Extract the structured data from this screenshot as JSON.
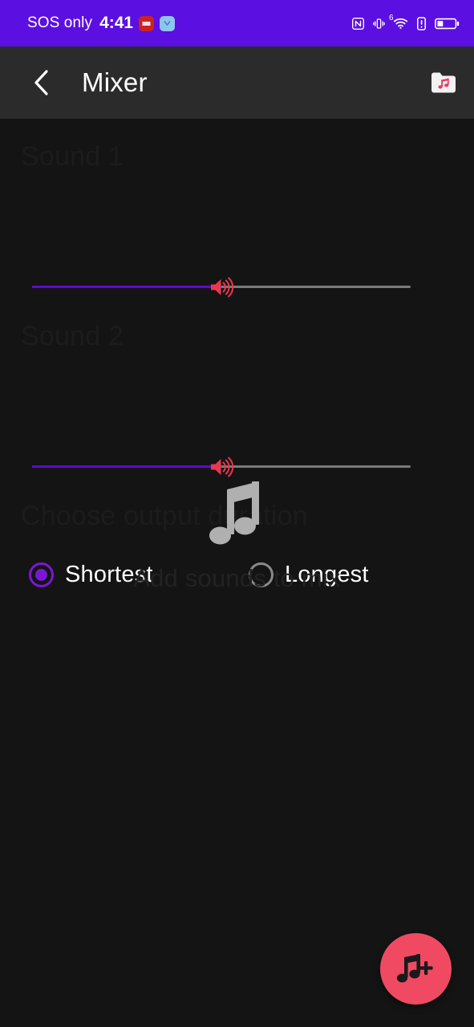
{
  "status_bar": {
    "carrier": "SOS only",
    "time": "4:41",
    "app_badges": [
      {
        "name": "red-app-badge",
        "color": "#cc2222"
      },
      {
        "name": "blue-app-badge",
        "color": "#8fc4ee"
      }
    ],
    "icons": [
      "nfc-icon",
      "vibrate-icon",
      "wifi-icon",
      "alert-icon",
      "battery-icon"
    ],
    "wifi_generation": "6",
    "background_color": "#5B0FE0"
  },
  "app_bar": {
    "back_label": "Back",
    "title": "Mixer",
    "folder_label": "Sound folder",
    "background_color": "#2b2b2b"
  },
  "sounds": [
    {
      "label": "Sound 1",
      "volume_percent": 50,
      "track_fill_color": "#6206d8",
      "track_bg_color": "#7a7a7a",
      "thumb_color": "#e8384f"
    },
    {
      "label": "Sound 2",
      "volume_percent": 50,
      "track_fill_color": "#6206d8",
      "track_bg_color": "#7a7a7a",
      "thumb_color": "#e8384f"
    }
  ],
  "duration_section": {
    "heading": "Choose output duration",
    "options": [
      {
        "label": "Shortest",
        "selected": true
      },
      {
        "label": "Longest",
        "selected": false
      }
    ],
    "selected_color": "#7c16d6",
    "unselected_color": "#8a8a8a"
  },
  "empty_state": {
    "icon": "music-note-icon",
    "message": "Add sounds to mix",
    "icon_color": "#b0b0b0",
    "text_color": "#222222"
  },
  "fab": {
    "label": "Add sound",
    "icon": "music-note-plus-icon",
    "background_color": "#f04a63"
  }
}
